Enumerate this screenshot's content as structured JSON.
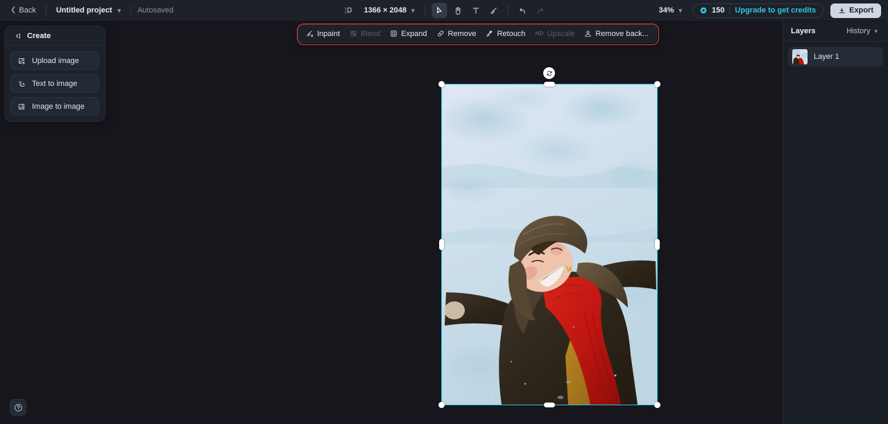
{
  "app": {
    "background_color": "#16161c",
    "topbar_color": "#1d2129",
    "accent_color": "#2ec8e0",
    "selection_color": "#26c6d6",
    "highlight_outline_color": "#ef3e36"
  },
  "topbar": {
    "back_label": "Back",
    "project_name": "Untitled project",
    "save_status": "Autosaved",
    "canvas_size": "1366 × 2048",
    "tools": [
      {
        "name": "select-tool",
        "icon": "cursor-arrow-icon",
        "active": true,
        "disabled": false
      },
      {
        "name": "hand-tool",
        "icon": "hand-icon",
        "active": false,
        "disabled": false
      },
      {
        "name": "text-tool",
        "icon": "text-icon",
        "active": false,
        "disabled": false
      },
      {
        "name": "brush-tool",
        "icon": "brush-icon",
        "active": false,
        "disabled": false
      }
    ],
    "history_tools": [
      {
        "name": "undo-button",
        "icon": "undo-icon",
        "disabled": false
      },
      {
        "name": "redo-button",
        "icon": "redo-icon",
        "disabled": true
      }
    ],
    "zoom_level": "34%",
    "credits_count": "150",
    "upgrade_label": "Upgrade to get credits",
    "export_label": "Export"
  },
  "create_panel": {
    "title": "Create",
    "items": [
      {
        "label": "Upload image",
        "icon": "image-upload-icon"
      },
      {
        "label": "Text to image",
        "icon": "text-to-image-icon"
      },
      {
        "label": "Image to image",
        "icon": "image-to-image-icon"
      }
    ]
  },
  "edit_toolbar": {
    "highlighted": true,
    "items": [
      {
        "label": "Inpaint",
        "icon": "inpaint-icon",
        "disabled": false,
        "prefix": ""
      },
      {
        "label": "Blend",
        "icon": "blend-icon",
        "disabled": true,
        "prefix": ""
      },
      {
        "label": "Expand",
        "icon": "expand-icon",
        "disabled": false,
        "prefix": ""
      },
      {
        "label": "Remove",
        "icon": "eraser-icon",
        "disabled": false,
        "prefix": ""
      },
      {
        "label": "Retouch",
        "icon": "retouch-icon",
        "disabled": false,
        "prefix": ""
      },
      {
        "label": "Upscale",
        "icon": "upscale-icon",
        "disabled": true,
        "prefix": "HD"
      },
      {
        "label": "Remove back...",
        "icon": "remove-background-icon",
        "disabled": false,
        "prefix": ""
      }
    ]
  },
  "canvas": {
    "image_description": "Woman lying in snow wearing a fur hat, dark brown shearling coat, red knit scarf and mustard shirt",
    "selected": true,
    "rotate_handle_icon": "rotate-icon"
  },
  "layers_panel": {
    "title": "Layers",
    "history_label": "History",
    "layers": [
      {
        "name": "Layer 1",
        "selected": true
      }
    ]
  },
  "help": {
    "icon": "help-circle-icon"
  }
}
